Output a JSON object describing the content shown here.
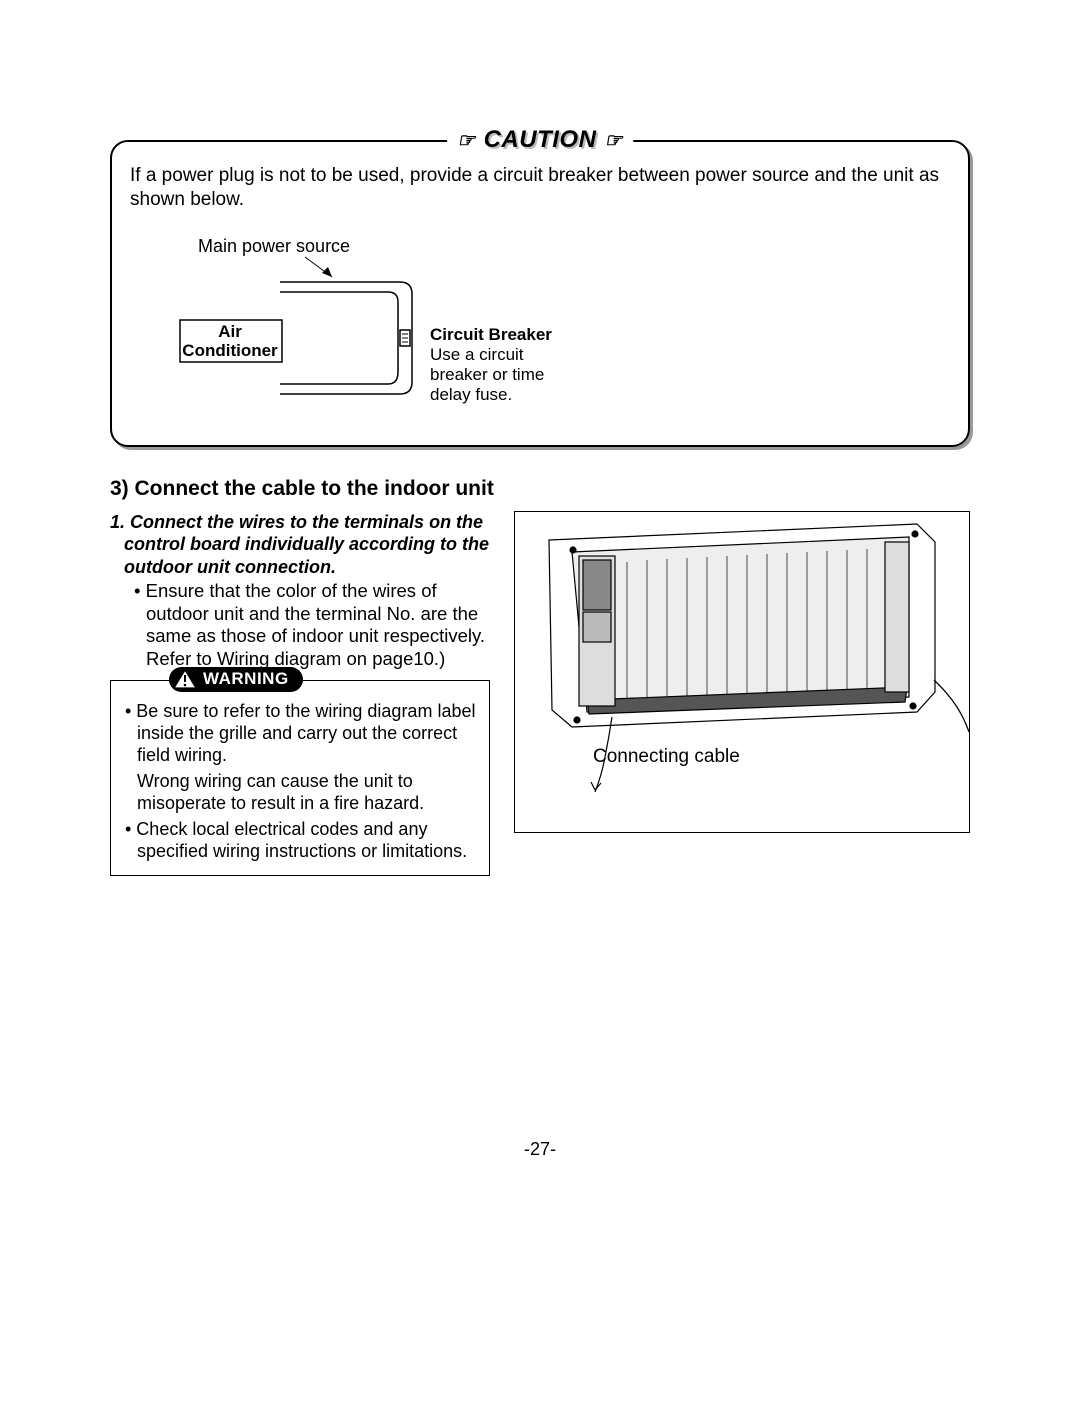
{
  "caution": {
    "title": "CAUTION",
    "text": "If a power plug is not to be used, provide a circuit breaker between power source and the unit as shown below.",
    "main_power_label": "Main power source",
    "air_conditioner_label_line1": "Air",
    "air_conditioner_label_line2": "Conditioner",
    "breaker_title": "Circuit Breaker",
    "breaker_desc": "Use a circuit breaker or time delay fuse."
  },
  "section": {
    "heading": "3) Connect the cable to the indoor unit",
    "step_head": "1. Connect the wires to the terminals on the control board individually according to the outdoor unit connection.",
    "bullet1": "• Ensure that the color of the wires of  outdoor unit and the terminal No. are the same as those of indoor unit respectively.",
    "refer": "Refer to Wiring diagram on page10.)"
  },
  "warning": {
    "label": "WARNING",
    "bullet1": "• Be sure to refer to the wiring diagram label inside the grille and carry out the correct field wiring.",
    "bullet1b": "Wrong wiring can cause the unit to misoperate to result in a fire hazard.",
    "bullet2": "• Check local electrical codes and any specified wiring instructions or limitations."
  },
  "figure": {
    "caption": "Connecting cable"
  },
  "page_number": "-27-"
}
